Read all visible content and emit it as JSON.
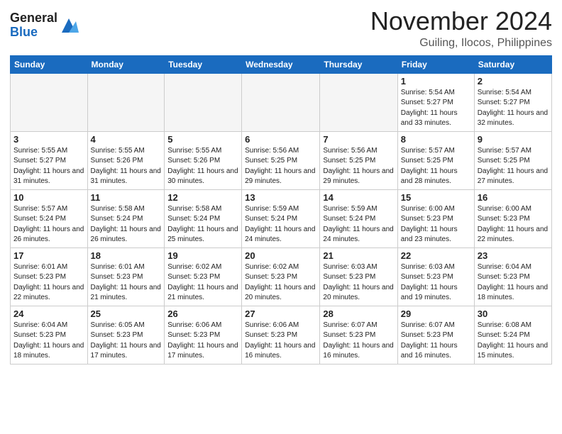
{
  "header": {
    "logo_general": "General",
    "logo_blue": "Blue",
    "month": "November 2024",
    "location": "Guiling, Ilocos, Philippines"
  },
  "days_of_week": [
    "Sunday",
    "Monday",
    "Tuesday",
    "Wednesday",
    "Thursday",
    "Friday",
    "Saturday"
  ],
  "weeks": [
    [
      {
        "day": "",
        "info": ""
      },
      {
        "day": "",
        "info": ""
      },
      {
        "day": "",
        "info": ""
      },
      {
        "day": "",
        "info": ""
      },
      {
        "day": "",
        "info": ""
      },
      {
        "day": "1",
        "info": "Sunrise: 5:54 AM\nSunset: 5:27 PM\nDaylight: 11 hours and 33 minutes."
      },
      {
        "day": "2",
        "info": "Sunrise: 5:54 AM\nSunset: 5:27 PM\nDaylight: 11 hours and 32 minutes."
      }
    ],
    [
      {
        "day": "3",
        "info": "Sunrise: 5:55 AM\nSunset: 5:27 PM\nDaylight: 11 hours and 31 minutes."
      },
      {
        "day": "4",
        "info": "Sunrise: 5:55 AM\nSunset: 5:26 PM\nDaylight: 11 hours and 31 minutes."
      },
      {
        "day": "5",
        "info": "Sunrise: 5:55 AM\nSunset: 5:26 PM\nDaylight: 11 hours and 30 minutes."
      },
      {
        "day": "6",
        "info": "Sunrise: 5:56 AM\nSunset: 5:25 PM\nDaylight: 11 hours and 29 minutes."
      },
      {
        "day": "7",
        "info": "Sunrise: 5:56 AM\nSunset: 5:25 PM\nDaylight: 11 hours and 29 minutes."
      },
      {
        "day": "8",
        "info": "Sunrise: 5:57 AM\nSunset: 5:25 PM\nDaylight: 11 hours and 28 minutes."
      },
      {
        "day": "9",
        "info": "Sunrise: 5:57 AM\nSunset: 5:25 PM\nDaylight: 11 hours and 27 minutes."
      }
    ],
    [
      {
        "day": "10",
        "info": "Sunrise: 5:57 AM\nSunset: 5:24 PM\nDaylight: 11 hours and 26 minutes."
      },
      {
        "day": "11",
        "info": "Sunrise: 5:58 AM\nSunset: 5:24 PM\nDaylight: 11 hours and 26 minutes."
      },
      {
        "day": "12",
        "info": "Sunrise: 5:58 AM\nSunset: 5:24 PM\nDaylight: 11 hours and 25 minutes."
      },
      {
        "day": "13",
        "info": "Sunrise: 5:59 AM\nSunset: 5:24 PM\nDaylight: 11 hours and 24 minutes."
      },
      {
        "day": "14",
        "info": "Sunrise: 5:59 AM\nSunset: 5:24 PM\nDaylight: 11 hours and 24 minutes."
      },
      {
        "day": "15",
        "info": "Sunrise: 6:00 AM\nSunset: 5:23 PM\nDaylight: 11 hours and 23 minutes."
      },
      {
        "day": "16",
        "info": "Sunrise: 6:00 AM\nSunset: 5:23 PM\nDaylight: 11 hours and 22 minutes."
      }
    ],
    [
      {
        "day": "17",
        "info": "Sunrise: 6:01 AM\nSunset: 5:23 PM\nDaylight: 11 hours and 22 minutes."
      },
      {
        "day": "18",
        "info": "Sunrise: 6:01 AM\nSunset: 5:23 PM\nDaylight: 11 hours and 21 minutes."
      },
      {
        "day": "19",
        "info": "Sunrise: 6:02 AM\nSunset: 5:23 PM\nDaylight: 11 hours and 21 minutes."
      },
      {
        "day": "20",
        "info": "Sunrise: 6:02 AM\nSunset: 5:23 PM\nDaylight: 11 hours and 20 minutes."
      },
      {
        "day": "21",
        "info": "Sunrise: 6:03 AM\nSunset: 5:23 PM\nDaylight: 11 hours and 20 minutes."
      },
      {
        "day": "22",
        "info": "Sunrise: 6:03 AM\nSunset: 5:23 PM\nDaylight: 11 hours and 19 minutes."
      },
      {
        "day": "23",
        "info": "Sunrise: 6:04 AM\nSunset: 5:23 PM\nDaylight: 11 hours and 18 minutes."
      }
    ],
    [
      {
        "day": "24",
        "info": "Sunrise: 6:04 AM\nSunset: 5:23 PM\nDaylight: 11 hours and 18 minutes."
      },
      {
        "day": "25",
        "info": "Sunrise: 6:05 AM\nSunset: 5:23 PM\nDaylight: 11 hours and 17 minutes."
      },
      {
        "day": "26",
        "info": "Sunrise: 6:06 AM\nSunset: 5:23 PM\nDaylight: 11 hours and 17 minutes."
      },
      {
        "day": "27",
        "info": "Sunrise: 6:06 AM\nSunset: 5:23 PM\nDaylight: 11 hours and 16 minutes."
      },
      {
        "day": "28",
        "info": "Sunrise: 6:07 AM\nSunset: 5:23 PM\nDaylight: 11 hours and 16 minutes."
      },
      {
        "day": "29",
        "info": "Sunrise: 6:07 AM\nSunset: 5:23 PM\nDaylight: 11 hours and 16 minutes."
      },
      {
        "day": "30",
        "info": "Sunrise: 6:08 AM\nSunset: 5:24 PM\nDaylight: 11 hours and 15 minutes."
      }
    ]
  ]
}
